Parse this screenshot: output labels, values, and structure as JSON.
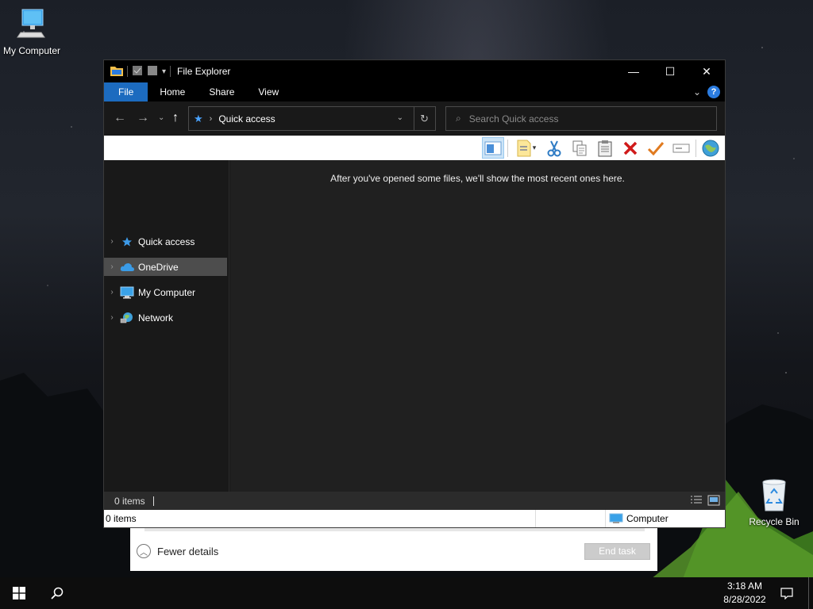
{
  "desktop": {
    "icons": [
      {
        "label": "My Computer",
        "icon": "computer-icon"
      },
      {
        "label": "Recycle Bin",
        "icon": "recycle-bin-icon"
      }
    ]
  },
  "task_manager": {
    "fewer_details": "Fewer details",
    "end_task": "End task"
  },
  "explorer": {
    "title": "File Explorer",
    "window_controls": {
      "minimize": "—",
      "maximize": "☐",
      "close": "✕"
    },
    "ribbon_tabs": [
      "File",
      "Home",
      "Share",
      "View"
    ],
    "help": "?",
    "address": {
      "location": "Quick access"
    },
    "search": {
      "placeholder": "Search Quick access"
    },
    "nav_items": [
      {
        "label": "Quick access",
        "icon": "star-icon",
        "selected": false
      },
      {
        "label": "OneDrive",
        "icon": "cloud-icon",
        "selected": true
      },
      {
        "label": "My Computer",
        "icon": "computer-icon",
        "selected": false
      },
      {
        "label": "Network",
        "icon": "network-icon",
        "selected": false
      }
    ],
    "empty_message": "After you've opened some files, we'll show the most recent ones here.",
    "status": {
      "item_count": "0 items"
    },
    "status2": {
      "item_count": "0 items",
      "location": "Computer"
    }
  },
  "taskbar": {
    "time": "3:18 AM",
    "date": "8/28/2022"
  },
  "colors": {
    "accent": "#1c6bbf",
    "selected_nav": "#4d4d4d",
    "content_bg": "#202020"
  }
}
